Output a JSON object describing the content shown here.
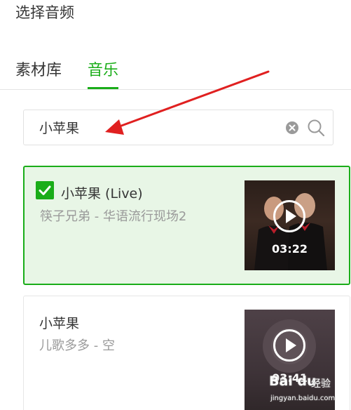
{
  "dialog": {
    "title": "选择音频"
  },
  "tabs": [
    {
      "label": "素材库",
      "active": false
    },
    {
      "label": "音乐",
      "active": true
    }
  ],
  "search": {
    "value": "小苹果",
    "placeholder": ""
  },
  "colors": {
    "accent": "#1aad19",
    "selected_bg": "#e8f6e6",
    "arrow": "#e02020"
  },
  "results": [
    {
      "title": "小苹果 (Live)",
      "subtitle": "筷子兄弟 - 华语流行现场2",
      "duration": "03:22",
      "selected": true
    },
    {
      "title": "小苹果",
      "subtitle": "儿歌多多 - 空",
      "duration": "03:41",
      "selected": false
    }
  ],
  "watermark": {
    "logo": "Bai du",
    "name": "经验",
    "url": "jingyan.baidu.com"
  }
}
